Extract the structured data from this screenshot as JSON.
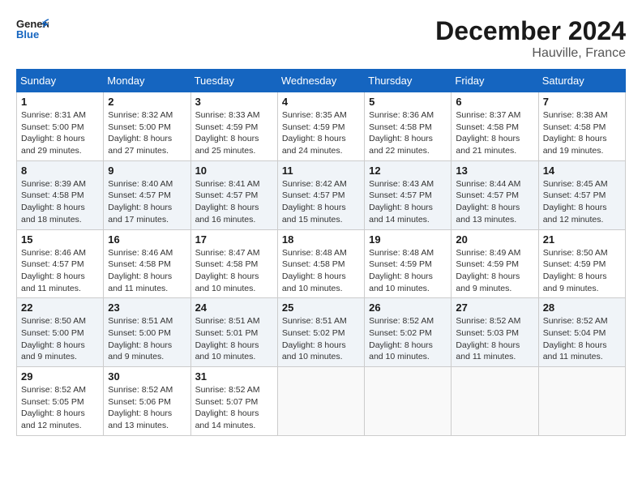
{
  "header": {
    "logo_general": "General",
    "logo_blue": "Blue",
    "month": "December 2024",
    "location": "Hauville, France"
  },
  "days_of_week": [
    "Sunday",
    "Monday",
    "Tuesday",
    "Wednesday",
    "Thursday",
    "Friday",
    "Saturday"
  ],
  "weeks": [
    [
      {
        "day": "1",
        "sunrise": "Sunrise: 8:31 AM",
        "sunset": "Sunset: 5:00 PM",
        "daylight": "Daylight: 8 hours and 29 minutes."
      },
      {
        "day": "2",
        "sunrise": "Sunrise: 8:32 AM",
        "sunset": "Sunset: 5:00 PM",
        "daylight": "Daylight: 8 hours and 27 minutes."
      },
      {
        "day": "3",
        "sunrise": "Sunrise: 8:33 AM",
        "sunset": "Sunset: 4:59 PM",
        "daylight": "Daylight: 8 hours and 25 minutes."
      },
      {
        "day": "4",
        "sunrise": "Sunrise: 8:35 AM",
        "sunset": "Sunset: 4:59 PM",
        "daylight": "Daylight: 8 hours and 24 minutes."
      },
      {
        "day": "5",
        "sunrise": "Sunrise: 8:36 AM",
        "sunset": "Sunset: 4:58 PM",
        "daylight": "Daylight: 8 hours and 22 minutes."
      },
      {
        "day": "6",
        "sunrise": "Sunrise: 8:37 AM",
        "sunset": "Sunset: 4:58 PM",
        "daylight": "Daylight: 8 hours and 21 minutes."
      },
      {
        "day": "7",
        "sunrise": "Sunrise: 8:38 AM",
        "sunset": "Sunset: 4:58 PM",
        "daylight": "Daylight: 8 hours and 19 minutes."
      }
    ],
    [
      {
        "day": "8",
        "sunrise": "Sunrise: 8:39 AM",
        "sunset": "Sunset: 4:58 PM",
        "daylight": "Daylight: 8 hours and 18 minutes."
      },
      {
        "day": "9",
        "sunrise": "Sunrise: 8:40 AM",
        "sunset": "Sunset: 4:57 PM",
        "daylight": "Daylight: 8 hours and 17 minutes."
      },
      {
        "day": "10",
        "sunrise": "Sunrise: 8:41 AM",
        "sunset": "Sunset: 4:57 PM",
        "daylight": "Daylight: 8 hours and 16 minutes."
      },
      {
        "day": "11",
        "sunrise": "Sunrise: 8:42 AM",
        "sunset": "Sunset: 4:57 PM",
        "daylight": "Daylight: 8 hours and 15 minutes."
      },
      {
        "day": "12",
        "sunrise": "Sunrise: 8:43 AM",
        "sunset": "Sunset: 4:57 PM",
        "daylight": "Daylight: 8 hours and 14 minutes."
      },
      {
        "day": "13",
        "sunrise": "Sunrise: 8:44 AM",
        "sunset": "Sunset: 4:57 PM",
        "daylight": "Daylight: 8 hours and 13 minutes."
      },
      {
        "day": "14",
        "sunrise": "Sunrise: 8:45 AM",
        "sunset": "Sunset: 4:57 PM",
        "daylight": "Daylight: 8 hours and 12 minutes."
      }
    ],
    [
      {
        "day": "15",
        "sunrise": "Sunrise: 8:46 AM",
        "sunset": "Sunset: 4:57 PM",
        "daylight": "Daylight: 8 hours and 11 minutes."
      },
      {
        "day": "16",
        "sunrise": "Sunrise: 8:46 AM",
        "sunset": "Sunset: 4:58 PM",
        "daylight": "Daylight: 8 hours and 11 minutes."
      },
      {
        "day": "17",
        "sunrise": "Sunrise: 8:47 AM",
        "sunset": "Sunset: 4:58 PM",
        "daylight": "Daylight: 8 hours and 10 minutes."
      },
      {
        "day": "18",
        "sunrise": "Sunrise: 8:48 AM",
        "sunset": "Sunset: 4:58 PM",
        "daylight": "Daylight: 8 hours and 10 minutes."
      },
      {
        "day": "19",
        "sunrise": "Sunrise: 8:48 AM",
        "sunset": "Sunset: 4:59 PM",
        "daylight": "Daylight: 8 hours and 10 minutes."
      },
      {
        "day": "20",
        "sunrise": "Sunrise: 8:49 AM",
        "sunset": "Sunset: 4:59 PM",
        "daylight": "Daylight: 8 hours and 9 minutes."
      },
      {
        "day": "21",
        "sunrise": "Sunrise: 8:50 AM",
        "sunset": "Sunset: 4:59 PM",
        "daylight": "Daylight: 8 hours and 9 minutes."
      }
    ],
    [
      {
        "day": "22",
        "sunrise": "Sunrise: 8:50 AM",
        "sunset": "Sunset: 5:00 PM",
        "daylight": "Daylight: 8 hours and 9 minutes."
      },
      {
        "day": "23",
        "sunrise": "Sunrise: 8:51 AM",
        "sunset": "Sunset: 5:00 PM",
        "daylight": "Daylight: 8 hours and 9 minutes."
      },
      {
        "day": "24",
        "sunrise": "Sunrise: 8:51 AM",
        "sunset": "Sunset: 5:01 PM",
        "daylight": "Daylight: 8 hours and 10 minutes."
      },
      {
        "day": "25",
        "sunrise": "Sunrise: 8:51 AM",
        "sunset": "Sunset: 5:02 PM",
        "daylight": "Daylight: 8 hours and 10 minutes."
      },
      {
        "day": "26",
        "sunrise": "Sunrise: 8:52 AM",
        "sunset": "Sunset: 5:02 PM",
        "daylight": "Daylight: 8 hours and 10 minutes."
      },
      {
        "day": "27",
        "sunrise": "Sunrise: 8:52 AM",
        "sunset": "Sunset: 5:03 PM",
        "daylight": "Daylight: 8 hours and 11 minutes."
      },
      {
        "day": "28",
        "sunrise": "Sunrise: 8:52 AM",
        "sunset": "Sunset: 5:04 PM",
        "daylight": "Daylight: 8 hours and 11 minutes."
      }
    ],
    [
      {
        "day": "29",
        "sunrise": "Sunrise: 8:52 AM",
        "sunset": "Sunset: 5:05 PM",
        "daylight": "Daylight: 8 hours and 12 minutes."
      },
      {
        "day": "30",
        "sunrise": "Sunrise: 8:52 AM",
        "sunset": "Sunset: 5:06 PM",
        "daylight": "Daylight: 8 hours and 13 minutes."
      },
      {
        "day": "31",
        "sunrise": "Sunrise: 8:52 AM",
        "sunset": "Sunset: 5:07 PM",
        "daylight": "Daylight: 8 hours and 14 minutes."
      },
      null,
      null,
      null,
      null
    ]
  ]
}
